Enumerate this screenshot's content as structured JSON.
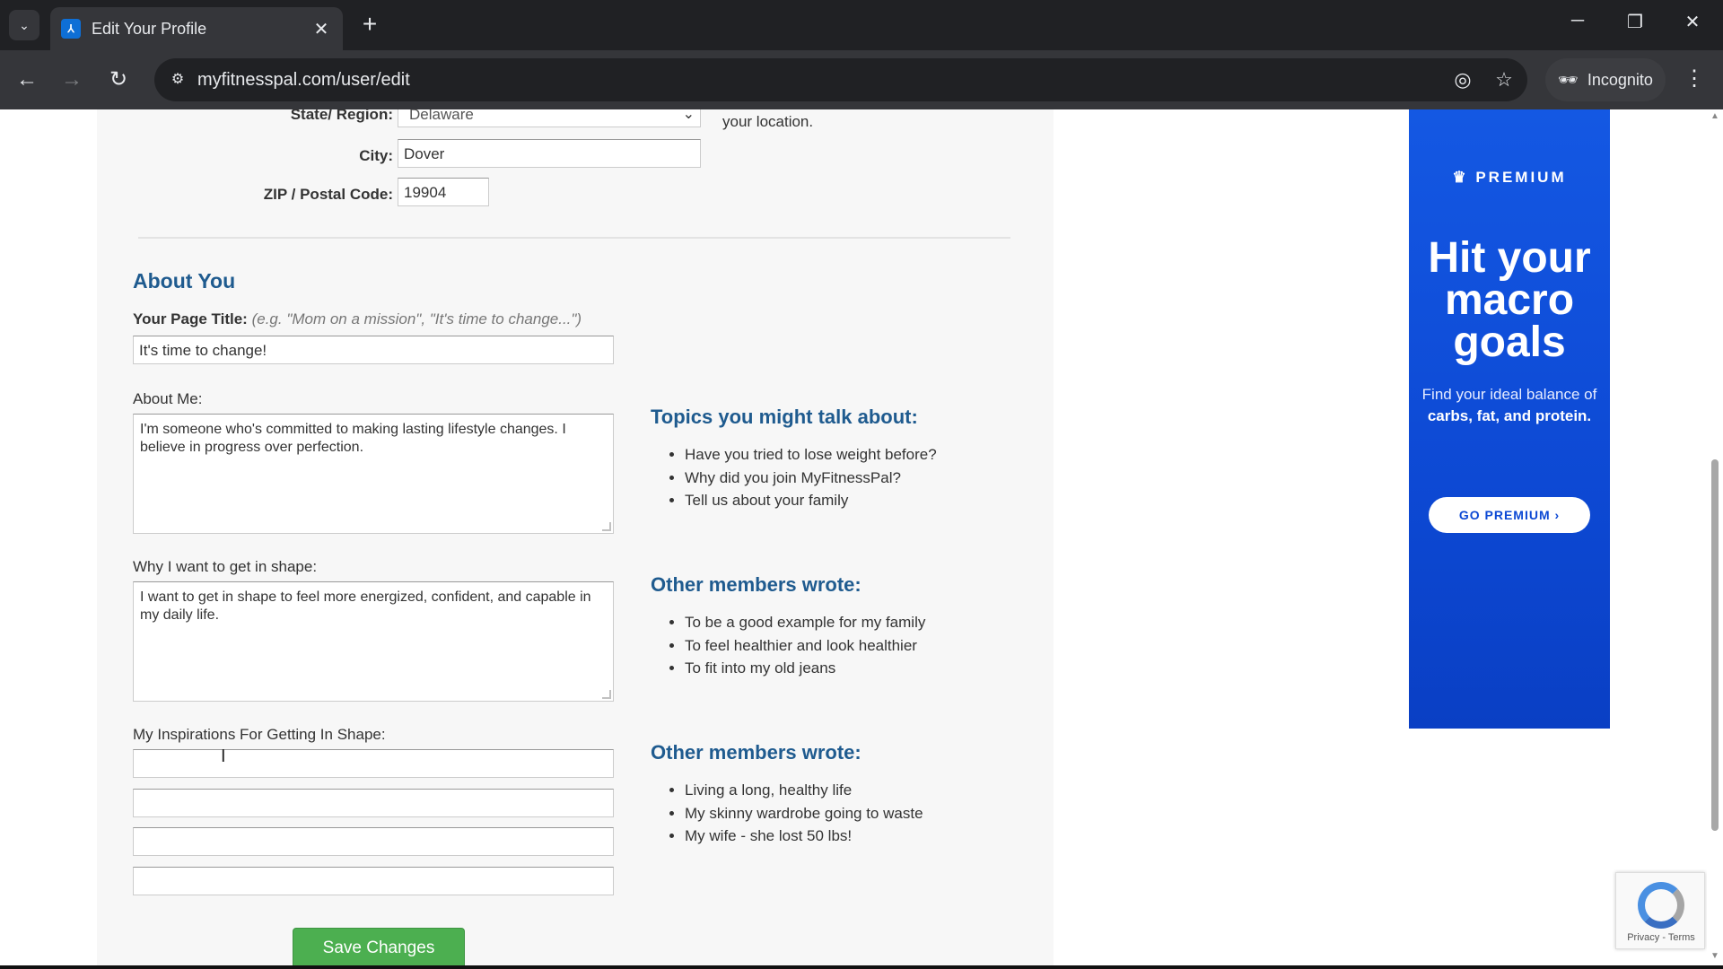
{
  "browser": {
    "tab_title": "Edit Your Profile",
    "url": "myfitnesspal.com/user/edit",
    "incognito_label": "Incognito"
  },
  "location": {
    "state_label": "State/ Region:",
    "state_value": "Delaware",
    "city_label": "City:",
    "city_value": "Dover",
    "zip_label": "ZIP / Postal Code:",
    "zip_value": "19904",
    "note": "your location."
  },
  "about": {
    "section_title": "About You",
    "page_title_label": "Your Page Title:",
    "page_title_hint": "(e.g. \"Mom on a mission\", \"It's time to change...\")",
    "page_title_value": "It's time to change!",
    "about_me_label": "About Me:",
    "about_me_value": "I'm someone who's committed to making lasting lifestyle changes. I believe in progress over perfection.",
    "why_label": "Why I want to get in shape:",
    "why_value": "I want to get in shape to feel more energized, confident, and capable in my daily life.",
    "inspirations_label": "My Inspirations For Getting In Shape:",
    "inspirations": [
      "",
      "",
      "",
      ""
    ]
  },
  "topics": {
    "title": "Topics you might talk about:",
    "items": [
      "Have you tried to lose weight before?",
      "Why did you join MyFitnessPal?",
      "Tell us about your family"
    ]
  },
  "others_why": {
    "title": "Other members wrote:",
    "items": [
      "To be a good example for my family",
      "To feel healthier and look healthier",
      "To fit into my old jeans"
    ]
  },
  "others_inspirations": {
    "title": "Other members wrote:",
    "items": [
      "Living a long, healthy life",
      "My skinny wardrobe going to waste",
      "My wife - she lost 50 lbs!"
    ]
  },
  "save_label": "Save Changes",
  "ad": {
    "badge": "PREMIUM",
    "headline_1": "Hit your",
    "headline_2": "macro",
    "headline_3": "goals",
    "sub_1": "Find your ideal balance of ",
    "sub_bold": "carbs, fat, and protein.",
    "button": "GO PREMIUM  ›"
  },
  "recaptcha": {
    "links": "Privacy - Terms"
  },
  "colors": {
    "accent": "#1f5b8f",
    "save_button": "#4caf50",
    "ad_blue": "#1458e3"
  }
}
